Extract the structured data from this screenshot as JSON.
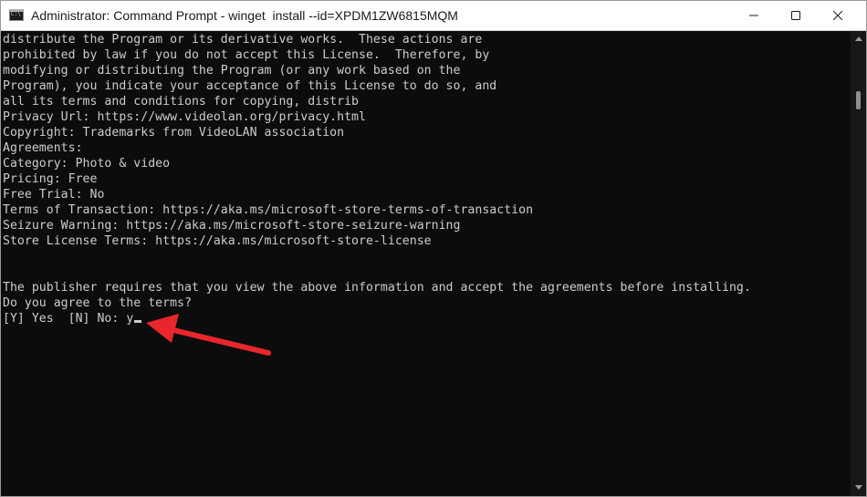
{
  "window": {
    "title": "Administrator: Command Prompt - winget  install --id=XPDM1ZW6815MQM",
    "minimize_label": "Minimize",
    "maximize_label": "Maximize",
    "close_label": "Close"
  },
  "console": {
    "lines": [
      "distribute the Program or its derivative works.  These actions are",
      "prohibited by law if you do not accept this License.  Therefore, by",
      "modifying or distributing the Program (or any work based on the",
      "Program), you indicate your acceptance of this License to do so, and",
      "all its terms and conditions for copying, distrib",
      "Privacy Url: https://www.videolan.org/privacy.html",
      "Copyright: Trademarks from VideoLAN association",
      "Agreements:",
      "Category: Photo & video",
      "Pricing: Free",
      "Free Trial: No",
      "Terms of Transaction: https://aka.ms/microsoft-store-terms-of-transaction",
      "Seizure Warning: https://aka.ms/microsoft-store-seizure-warning",
      "Store License Terms: https://aka.ms/microsoft-store-license",
      "",
      "",
      "The publisher requires that you view the above information and accept the agreements before installing.",
      "Do you agree to the terms?"
    ],
    "prompt": "[Y] Yes  [N] No: ",
    "input_value": "y"
  },
  "colors": {
    "console_background": "#0c0c0c",
    "console_text": "#cccccc",
    "annotation_arrow": "#e8262b"
  },
  "icons": {
    "app": "command-prompt-icon",
    "minimize": "minimize-icon",
    "maximize": "maximize-icon",
    "close": "close-icon",
    "annotation": "red-arrow-icon"
  }
}
